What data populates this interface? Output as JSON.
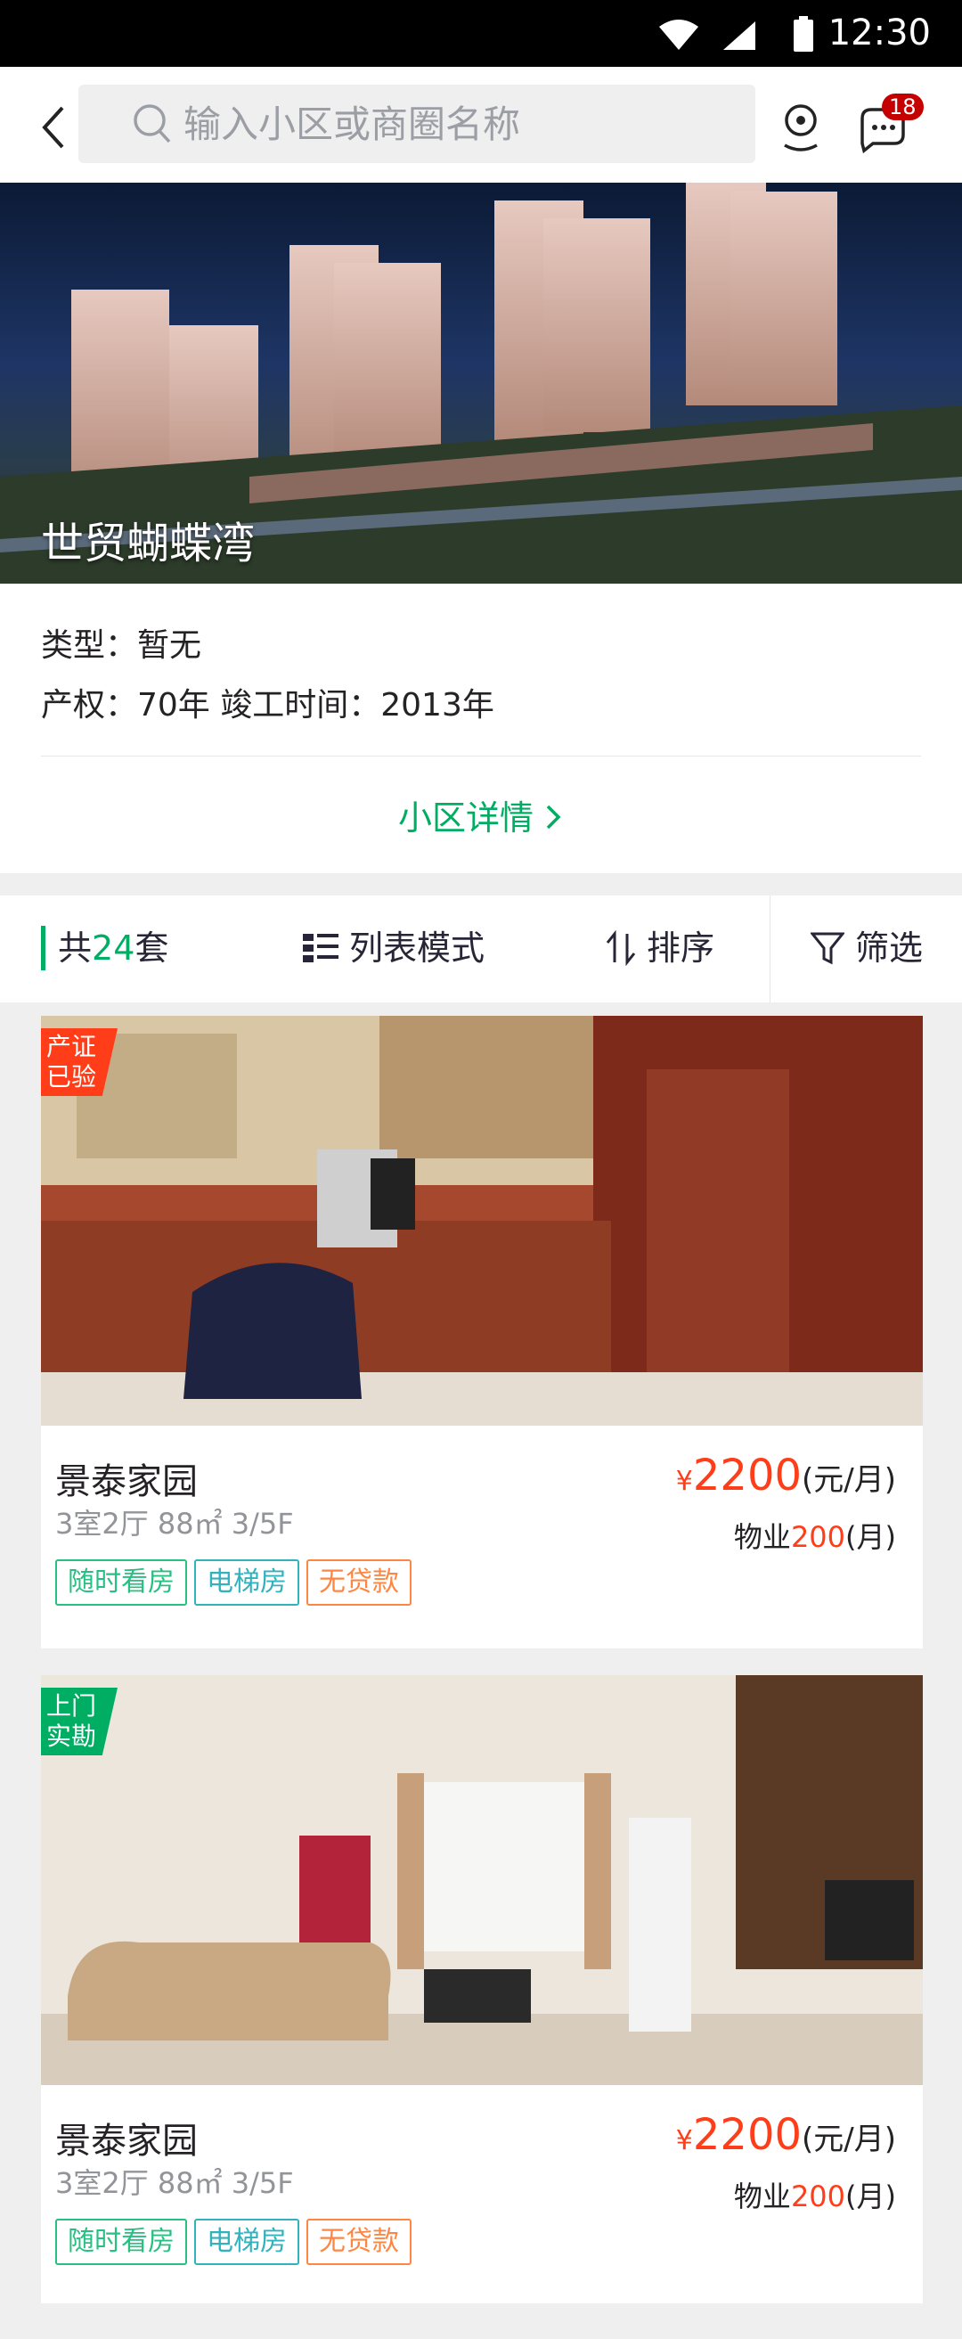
{
  "status_bar": {
    "time": "12:30"
  },
  "header": {
    "search_placeholder": "输入小区或商圈名称",
    "badge_count": "18"
  },
  "hero": {
    "title": "世贸蝴蝶湾"
  },
  "info": {
    "type": "类型：暂无",
    "property": "产权：70年   竣工时间：2013年",
    "detail_link": "小区详情"
  },
  "filter_bar": {
    "count_prefix": "共",
    "count_number": "24",
    "count_suffix": "套",
    "list_mode": "列表模式",
    "sort": "排序",
    "filter": "筛选"
  },
  "listings": [
    {
      "corner_tag": "产证已验",
      "title": "景泰家园",
      "meta": "3室2厅   88㎡  3/5F",
      "price_symbol": "¥",
      "price": "2200",
      "price_unit": "(元/月)",
      "fee_label": "物业",
      "fee": "200",
      "fee_unit": "(月)",
      "features": [
        "随时看房",
        "电梯房",
        "无贷款"
      ]
    },
    {
      "corner_tag": "上门实勘",
      "title": "景泰家园",
      "meta": "3室2厅   88㎡  3/5F",
      "price_symbol": "¥",
      "price": "2200",
      "price_unit": "(元/月)",
      "fee_label": "物业",
      "fee": "200",
      "fee_unit": "(月)",
      "features": [
        "随时看房",
        "电梯房",
        "无贷款"
      ]
    }
  ],
  "colors": {
    "accent_green": "#00ae63",
    "price_red": "#ff3d19",
    "badge_red": "#c40000",
    "text_dark": "#242224",
    "text_gray": "#939499"
  }
}
